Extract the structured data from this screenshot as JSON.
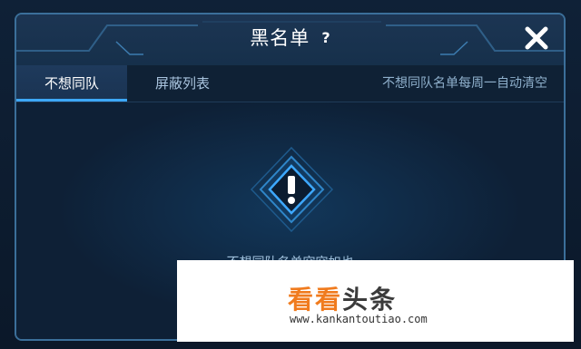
{
  "dialog": {
    "title": "黑名单",
    "help_label": "?",
    "close_label": "✕"
  },
  "tabs": [
    {
      "label": "不想同队",
      "active": true
    },
    {
      "label": "屏蔽列表",
      "active": false
    }
  ],
  "tab_note": "不想同队名单每周一自动清空",
  "empty_state": {
    "icon": "warning-exclamation-icon",
    "message": "不想同队名单空空如也"
  },
  "watermark": {
    "logo_colored": "看看",
    "logo_dark": "头条",
    "url": "www.kankantoutiao.com"
  },
  "colors": {
    "accent": "#3da8ff",
    "panel": "#0e2036",
    "border": "#3b6f9a",
    "text_dim": "#9fc0dc",
    "watermark_orange": "#f07b1e"
  }
}
